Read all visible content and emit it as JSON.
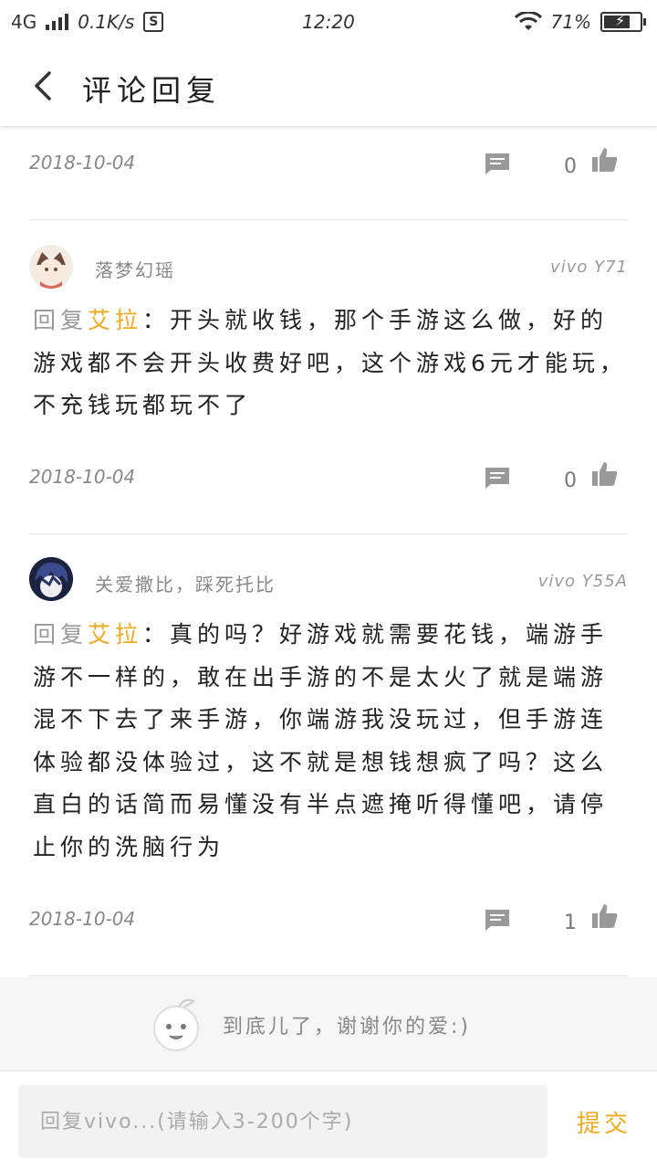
{
  "status_bar": {
    "network": "4G",
    "speed": "0.1K/s",
    "time": "12:20",
    "battery": "71%"
  },
  "header": {
    "title": "评论回复"
  },
  "replies": [
    {
      "date": "2018-10-04",
      "likes": "0"
    },
    {
      "username": "落梦幻瑶",
      "device": "vivo Y71",
      "reply_prefix": "回复",
      "mention": "艾拉",
      "text": "：开头就收钱，那个手游这么做，好的游戏都不会开头收费好吧，这个游戏6元才能玩，不充钱玩都玩不了",
      "date": "2018-10-04",
      "likes": "0"
    },
    {
      "username": "关爱撒比，踩死托比",
      "device": "vivo Y55A",
      "reply_prefix": "回复",
      "mention": "艾拉",
      "text": "：真的吗？好游戏就需要花钱，端游手游不一样的，敢在出手游的不是太火了就是端游混不下去了来手游，你端游我没玩过，但手游连体验都没体验过，这不就是想钱想疯了吗？这么直白的话简而易懂没有半点遮掩听得懂吧，请停止你的洗脑行为",
      "date": "2018-10-04",
      "likes": "1"
    }
  ],
  "end_message": "到底儿了，谢谢你的爱:)",
  "input": {
    "placeholder": "回复vivo...(请输入3-200个字)",
    "submit_label": "提交"
  },
  "colors": {
    "accent": "#f2a81d",
    "muted": "#888888"
  }
}
